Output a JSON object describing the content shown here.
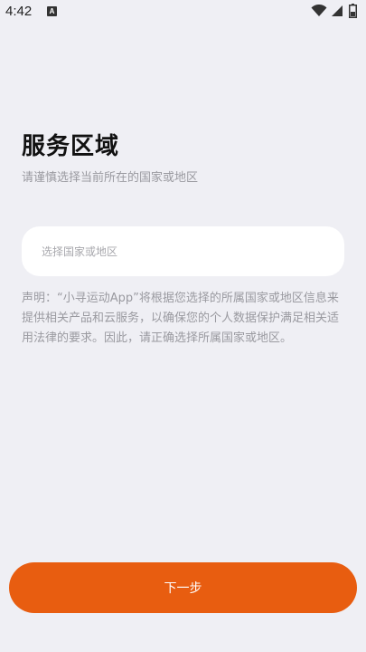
{
  "status_bar": {
    "time": "4:42",
    "notification_icon": "keyboard-a-icon",
    "icons": [
      "wifi-icon",
      "signal-icon",
      "battery-icon"
    ]
  },
  "header": {
    "title": "服务区域",
    "subtitle": "请谨慎选择当前所在的国家或地区"
  },
  "region_select": {
    "placeholder": "选择国家或地区"
  },
  "disclaimer": {
    "text": "声明：“小寻运动App”将根据您选择的所属国家或地区信息来 提供相关产品和云服务，以确保您的个人数据保护满足相关适 用法律的要求。因此，请正确选择所属国家或地区。"
  },
  "footer": {
    "next_label": "下一步"
  },
  "colors": {
    "background": "#efeff4",
    "accent": "#e85d10",
    "input_background": "#ffffff",
    "muted_text": "#9a9aa0"
  }
}
